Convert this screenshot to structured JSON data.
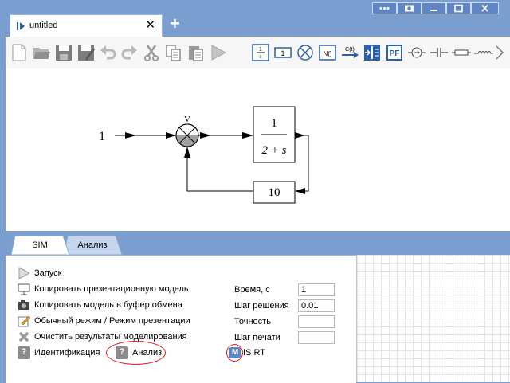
{
  "window": {
    "controls": [
      "dots-icon",
      "camera-icon",
      "minimize-icon",
      "maximize-icon",
      "close-icon"
    ]
  },
  "document_tab": {
    "title": "untitled",
    "close_glyph": "✕"
  },
  "new_tab_glyph": "+",
  "toolbar": {
    "buttons": [
      "new-file",
      "open",
      "save",
      "save-as",
      "undo",
      "redo",
      "cut",
      "copy",
      "paste",
      "run",
      "state-block",
      "gain-block",
      "sum-block",
      "nonlinear-block",
      "signal-source",
      "signal-scope",
      "pf-block",
      "circle-block",
      "capacitor-block",
      "resistor-block",
      "inductor-block",
      "scroll-right"
    ],
    "labels": {
      "gain": "1",
      "nonlinear": "N()",
      "source": "C(t)",
      "pf": "PF"
    }
  },
  "diagram": {
    "input_value": "1",
    "sum_label": "V",
    "tf_numerator": "1",
    "tf_denominator": "2 + s",
    "feedback_gain": "10",
    "colors": {
      "line": "#000000",
      "sum_fill_lower": "#a0a0a0"
    }
  },
  "panel": {
    "tabs": [
      {
        "label": "SIM",
        "active": true
      },
      {
        "label": "Анализ",
        "active": false
      }
    ],
    "actions": [
      {
        "icon": "play-icon",
        "label": "Запуск"
      },
      {
        "icon": "presentation-icon",
        "label": "Копировать презентационную модель"
      },
      {
        "icon": "camera-icon",
        "label": "Копировать модель в буфер обмена"
      },
      {
        "icon": "edit-mode-icon",
        "label": "Обычный режим / Режим презентации"
      },
      {
        "icon": "clear-icon",
        "label": "Очистить результаты моделирования"
      }
    ],
    "identification": {
      "icon_glyph": "?",
      "label": "Идентификация"
    },
    "analysis": {
      "icon_glyph": "?",
      "label": "Анализ"
    },
    "params": [
      {
        "label": "Время, с",
        "value": "1"
      },
      {
        "label": "Шаг решения",
        "value": "0.01"
      },
      {
        "label": "Точность",
        "value": ""
      },
      {
        "label": "Шаг печати",
        "value": ""
      }
    ],
    "mode": {
      "badge": "M",
      "label": "IS RT"
    },
    "colors": {
      "highlight": "#e02020",
      "badge_bg": "#5b86c9"
    }
  }
}
